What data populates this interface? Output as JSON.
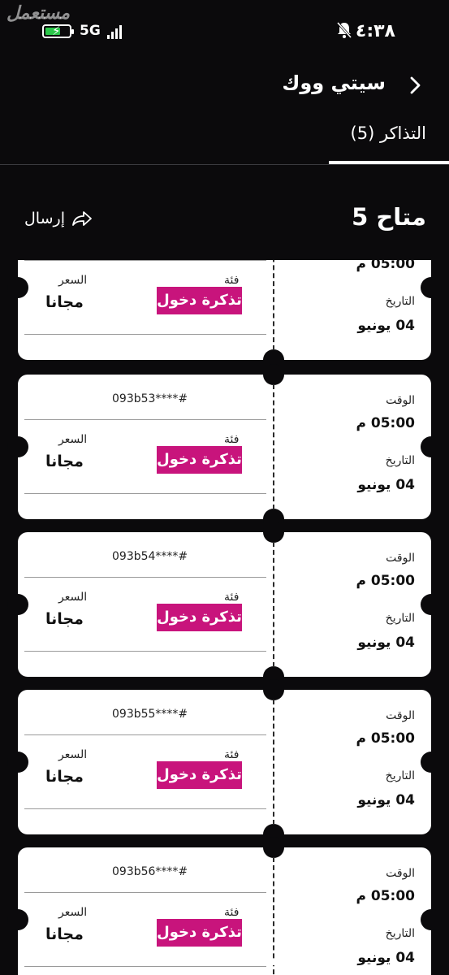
{
  "status_bar": {
    "watermark": "مستعمل",
    "network": "5G",
    "time": "٤:٣٨"
  },
  "header": {
    "title": "سيتي ووك",
    "tab_label": "التذاكر (5)"
  },
  "summary": {
    "available": "متاح 5",
    "send_label": "إرسال"
  },
  "ticket_labels": {
    "time": "الوقت",
    "date": "التاريخ",
    "category": "فئة",
    "price": "السعر"
  },
  "tickets": [
    {
      "code": "",
      "time": "05:00 م",
      "date": "04 يونيو",
      "category": "تذكرة دخول",
      "price": "مجانا"
    },
    {
      "code": "093b53****#",
      "time": "05:00 م",
      "date": "04 يونيو",
      "category": "تذكرة دخول",
      "price": "مجانا"
    },
    {
      "code": "093b54****#",
      "time": "05:00 م",
      "date": "04 يونيو",
      "category": "تذكرة دخول",
      "price": "مجانا"
    },
    {
      "code": "093b55****#",
      "time": "05:00 م",
      "date": "04 يونيو",
      "category": "تذكرة دخول",
      "price": "مجانا"
    },
    {
      "code": "093b56****#",
      "time": "05:00 م",
      "date": "04 يونيو",
      "category": "تذكرة دخول",
      "price": "مجانا"
    }
  ],
  "colors": {
    "background": "#0b0a0c",
    "badge": "#c8147c",
    "battery": "#2bc74a"
  }
}
